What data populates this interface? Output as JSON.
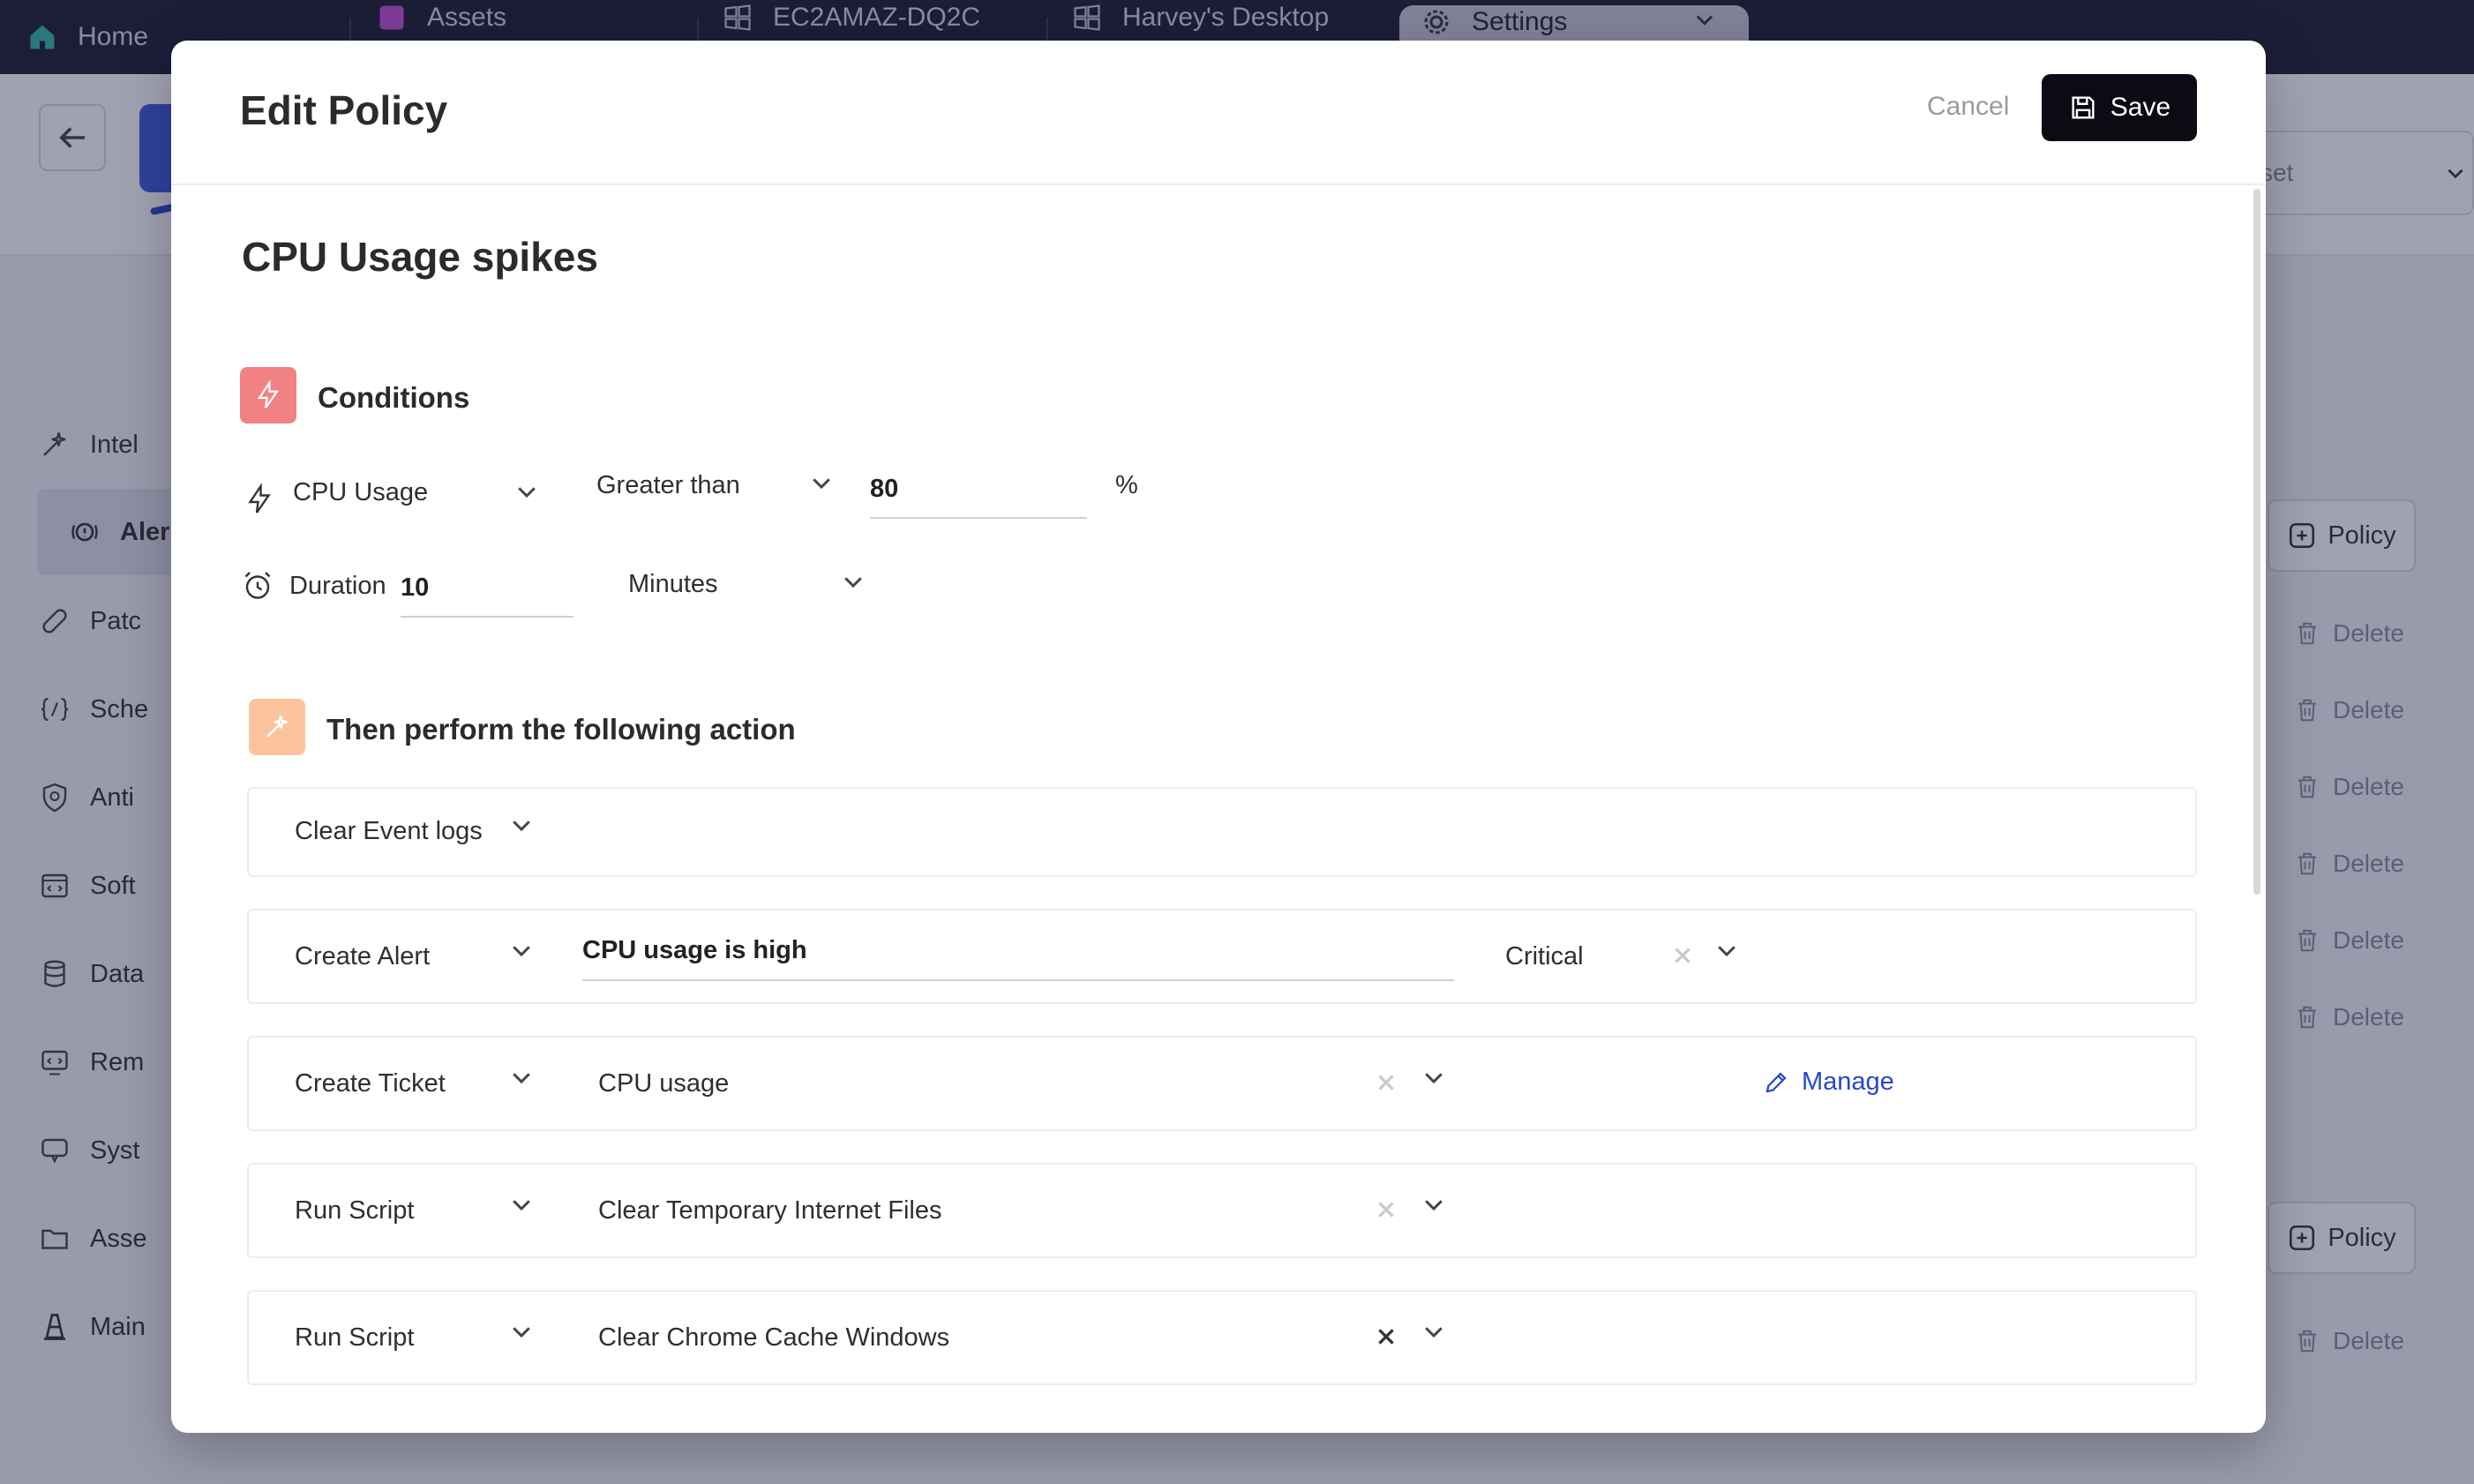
{
  "tabs": {
    "home": "Home",
    "assets": "Assets",
    "machine": "EC2AMAZ-DQ2C",
    "desktop": "Harvey's Desktop",
    "settings": "Settings"
  },
  "background": {
    "preset_label": "set",
    "sidebar": [
      "Intel",
      "Aler",
      "Patc",
      "Sche",
      "Anti",
      "Soft",
      "Data",
      "Rem",
      "Syst",
      "Asse",
      "Main"
    ],
    "policy_label": "Policy",
    "delete_label": "Delete"
  },
  "modal": {
    "title": "Edit Policy",
    "cancel": "Cancel",
    "save": "Save",
    "policy_name": "CPU Usage spikes"
  },
  "conditions": {
    "title": "Conditions",
    "metric": "CPU Usage",
    "operator": "Greater than",
    "threshold": "80",
    "unit": "%",
    "duration_label": "Duration",
    "duration_value": "10",
    "duration_unit": "Minutes"
  },
  "actions": {
    "title": "Then perform the following action",
    "items": [
      {
        "type": "Clear Event logs"
      },
      {
        "type": "Create Alert",
        "message": "CPU usage is high",
        "severity": "Critical"
      },
      {
        "type": "Create Ticket",
        "value": "CPU usage",
        "manage": "Manage"
      },
      {
        "type": "Run Script",
        "value": "Clear Temporary Internet Files"
      },
      {
        "type": "Run Script",
        "value": "Clear Chrome Cache Windows"
      }
    ]
  },
  "colors": {
    "accent": "#2549c9",
    "conditions_badge": "#f28282",
    "actions_badge": "#fbc49e",
    "save_button": "#0b0b14"
  }
}
